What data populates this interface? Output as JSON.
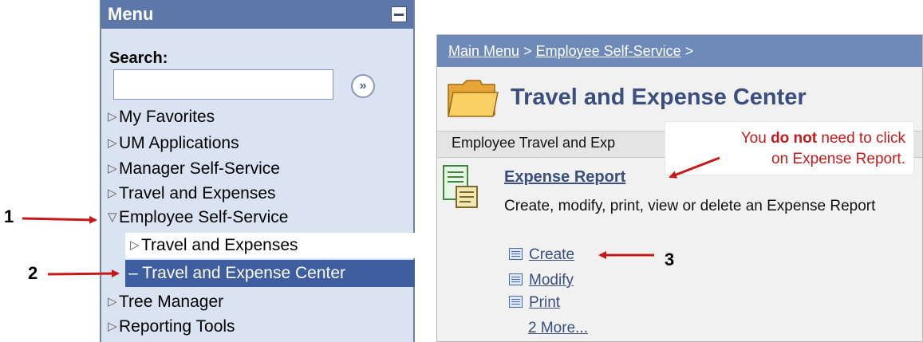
{
  "menu": {
    "title": "Menu",
    "search_label": "Search:",
    "search_value": "",
    "go_glyph": "»",
    "items": [
      {
        "label": "My Favorites"
      },
      {
        "label": "UM Applications"
      },
      {
        "label": "Manager Self-Service"
      },
      {
        "label": "Travel and Expenses"
      },
      {
        "label": "Employee Self-Service"
      },
      {
        "label": "Tree Manager"
      },
      {
        "label": "Reporting Tools"
      }
    ],
    "sub_items": [
      {
        "label": "Travel and Expenses"
      },
      {
        "label": "Travel and Expense Center"
      }
    ]
  },
  "breadcrumb": {
    "item1": "Main Menu",
    "sep": ">",
    "item2": "Employee Self-Service",
    "sep2": ">"
  },
  "content": {
    "title": "Travel and Expense Center",
    "section": "Employee Travel and Exp",
    "report_title": "Expense Report",
    "report_desc": "Create, modify, print, view or delete an Expense Report",
    "actions": [
      {
        "label": "Create"
      },
      {
        "label": "Modify"
      },
      {
        "label": "Print"
      }
    ],
    "more": "2 More..."
  },
  "annotation": {
    "line1_a": "You ",
    "line1_bold": "do not",
    "line1_b": " need to click",
    "line2": "on Expense Report.",
    "steps": [
      "1",
      "2",
      "3"
    ]
  },
  "colors": {
    "menu_header": "#5e77a9",
    "menu_bg": "#d9e3f1",
    "selected": "#3e5ea0",
    "breadcrumb_bg": "#6e8ab8",
    "link": "#3a4f7e",
    "annotation_red": "#c61a1a"
  },
  "icons": {
    "collapse": "minus-box-icon",
    "search_go": "double-chevron-right-icon",
    "expand": "triangle-right-icon",
    "expanded": "triangle-down-icon",
    "folder": "folder-icon",
    "report": "report-document-icon",
    "action": "list-icon"
  }
}
